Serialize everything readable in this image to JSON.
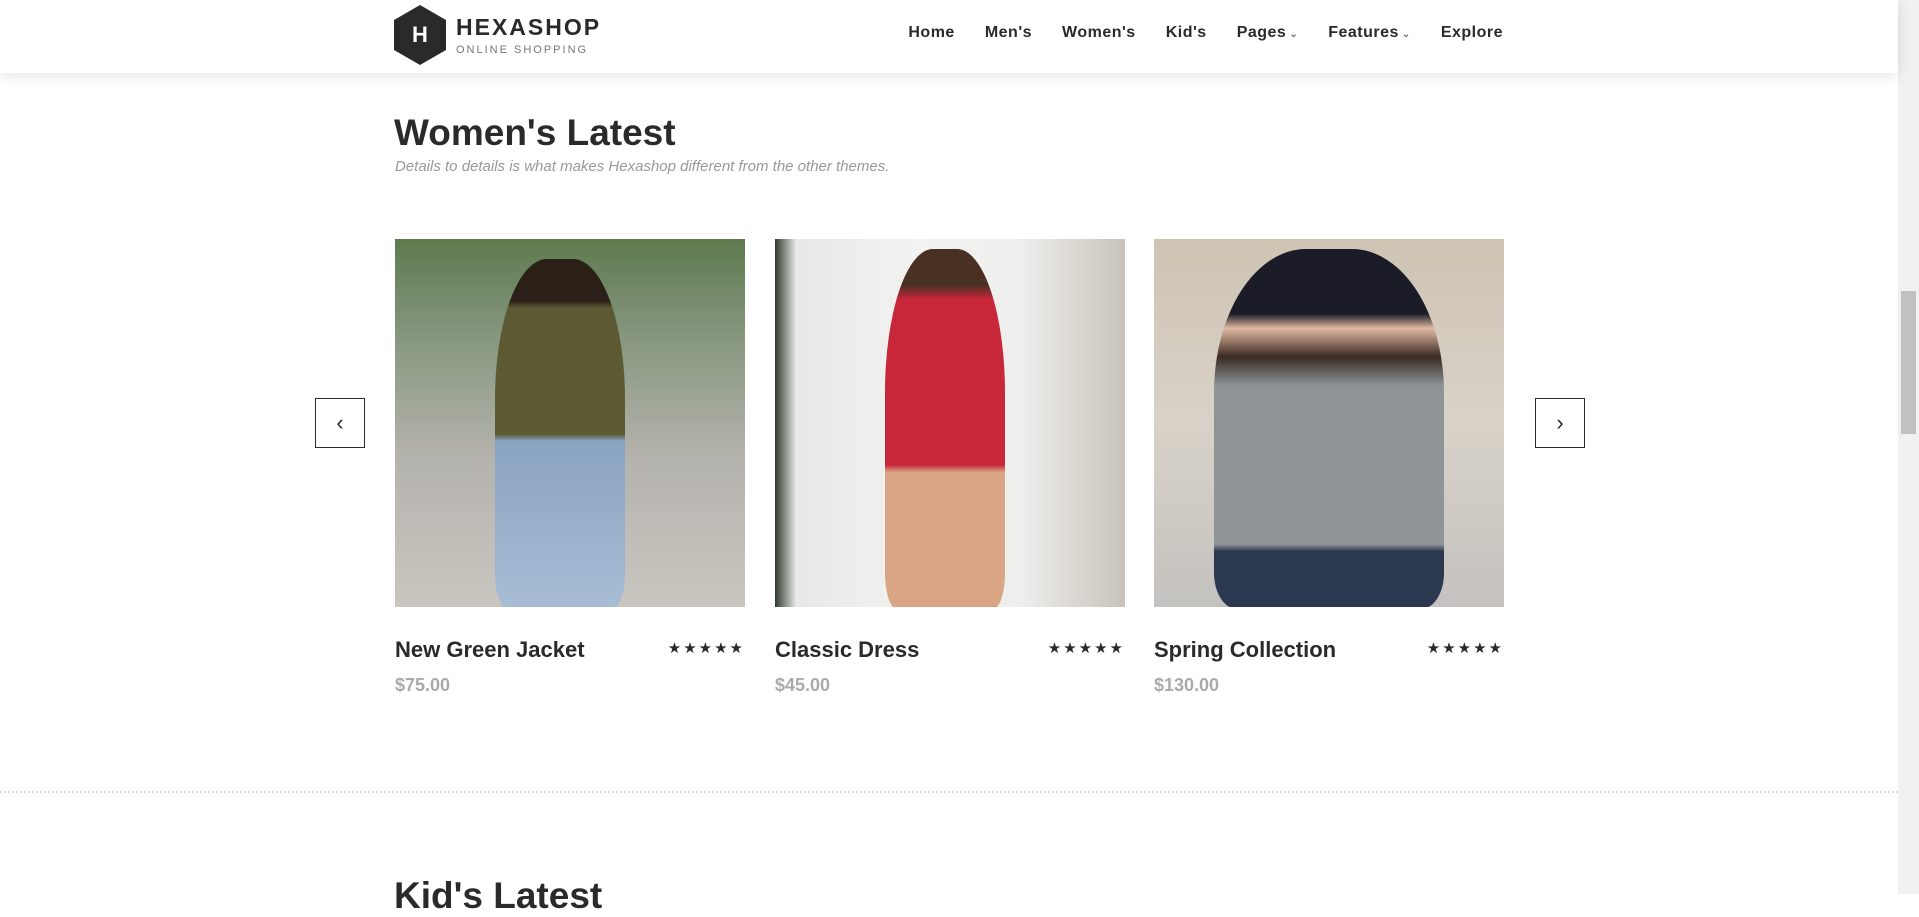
{
  "header": {
    "logo_letter": "H",
    "brand": "HEXASHOP",
    "tagline": "ONLINE SHOPPING",
    "nav": [
      {
        "label": "Home"
      },
      {
        "label": "Men's"
      },
      {
        "label": "Women's"
      },
      {
        "label": "Kid's"
      },
      {
        "label": "Pages",
        "dropdown": true
      },
      {
        "label": "Features",
        "dropdown": true
      },
      {
        "label": "Explore"
      }
    ]
  },
  "section": {
    "title": "Women's Latest",
    "subtitle": "Details to details is what makes Hexashop different from the other themes."
  },
  "products": [
    {
      "name": "New Green Jacket",
      "price": "$75.00",
      "rating": 5,
      "stars": "★★★★★"
    },
    {
      "name": "Classic Dress",
      "price": "$45.00",
      "rating": 5,
      "stars": "★★★★★"
    },
    {
      "name": "Spring Collection",
      "price": "$130.00",
      "rating": 5,
      "stars": "★★★★★"
    }
  ],
  "carousel": {
    "prev": "‹",
    "next": "›"
  },
  "next_section": {
    "title": "Kid's Latest"
  }
}
